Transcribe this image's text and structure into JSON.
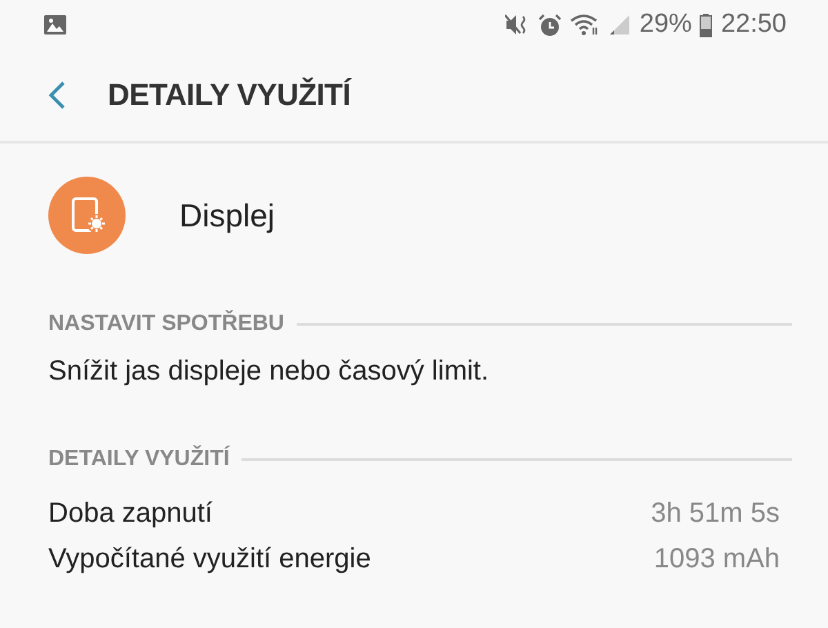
{
  "status_bar": {
    "battery": "29%",
    "time": "22:50"
  },
  "header": {
    "title": "DETAILY VYUŽITÍ"
  },
  "app": {
    "name": "Displej"
  },
  "sections": [
    {
      "title": "NASTAVIT SPOTŘEBU",
      "kind": "text",
      "text": "Snížit jas displeje nebo časový limit."
    },
    {
      "title": "DETAILY VYUŽITÍ",
      "kind": "rows",
      "rows": [
        {
          "label": "Doba zapnutí",
          "value": "3h 51m 5s"
        },
        {
          "label": "Vypočítané využití energie",
          "value": "1093 mAh"
        }
      ]
    }
  ]
}
